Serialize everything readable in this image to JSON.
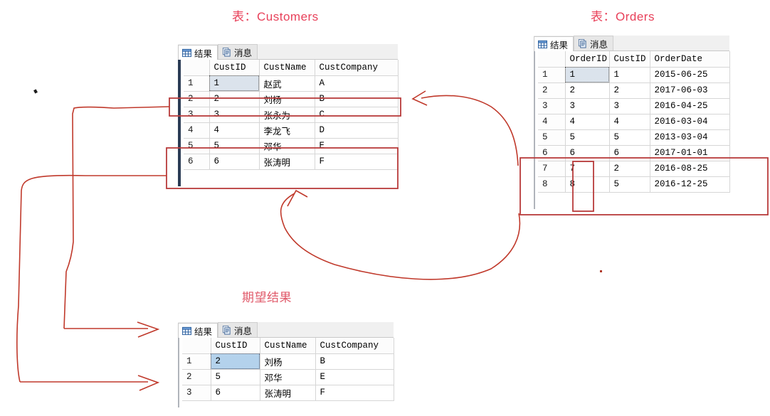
{
  "titles": {
    "customers": "表：Customers",
    "orders": "表：Orders",
    "expected": "期望结果"
  },
  "tabs": {
    "results_label": "结果",
    "messages_label": "消息",
    "results_icon": "grid-icon",
    "messages_icon": "document-icon"
  },
  "customers_table": {
    "columns": [
      "",
      "CustID",
      "CustName",
      "CustCompany"
    ],
    "rows": [
      {
        "n": "1",
        "CustID": "1",
        "CustName": "赵武",
        "CustCompany": "A"
      },
      {
        "n": "2",
        "CustID": "2",
        "CustName": "刘杨",
        "CustCompany": "B"
      },
      {
        "n": "3",
        "CustID": "3",
        "CustName": "张永为",
        "CustCompany": "C"
      },
      {
        "n": "4",
        "CustID": "4",
        "CustName": "李龙飞",
        "CustCompany": "D"
      },
      {
        "n": "5",
        "CustID": "5",
        "CustName": "邓华",
        "CustCompany": "E"
      },
      {
        "n": "6",
        "CustID": "6",
        "CustName": "张涛明",
        "CustCompany": "F"
      }
    ],
    "selected_cell": "1"
  },
  "orders_table": {
    "columns": [
      "",
      "OrderID",
      "CustID",
      "OrderDate"
    ],
    "rows": [
      {
        "n": "1",
        "OrderID": "1",
        "CustID": "1",
        "OrderDate": "2015-06-25"
      },
      {
        "n": "2",
        "OrderID": "2",
        "CustID": "2",
        "OrderDate": "2017-06-03"
      },
      {
        "n": "3",
        "OrderID": "3",
        "CustID": "3",
        "OrderDate": "2016-04-25"
      },
      {
        "n": "4",
        "OrderID": "4",
        "CustID": "4",
        "OrderDate": "2016-03-04"
      },
      {
        "n": "5",
        "OrderID": "5",
        "CustID": "5",
        "OrderDate": "2013-03-04"
      },
      {
        "n": "6",
        "OrderID": "6",
        "CustID": "6",
        "OrderDate": "2017-01-01"
      },
      {
        "n": "7",
        "OrderID": "7",
        "CustID": "2",
        "OrderDate": "2016-08-25"
      },
      {
        "n": "8",
        "OrderID": "8",
        "CustID": "5",
        "OrderDate": "2016-12-25"
      }
    ],
    "selected_cell": "1"
  },
  "expected_table": {
    "columns": [
      "",
      "CustID",
      "CustName",
      "CustCompany"
    ],
    "rows": [
      {
        "n": "1",
        "CustID": "2",
        "CustName": "刘杨",
        "CustCompany": "B"
      },
      {
        "n": "2",
        "CustID": "5",
        "CustName": "邓华",
        "CustCompany": "E"
      },
      {
        "n": "3",
        "CustID": "6",
        "CustName": "张涛明",
        "CustCompany": "F"
      }
    ],
    "selected_cell": "2"
  },
  "colors": {
    "title_red": "#e8415a",
    "ink_red": "#c0392b",
    "box_red": "#b83b3b",
    "selection_grey_blue": "#dbe3ec",
    "selection_blue": "#b4d2ec"
  }
}
